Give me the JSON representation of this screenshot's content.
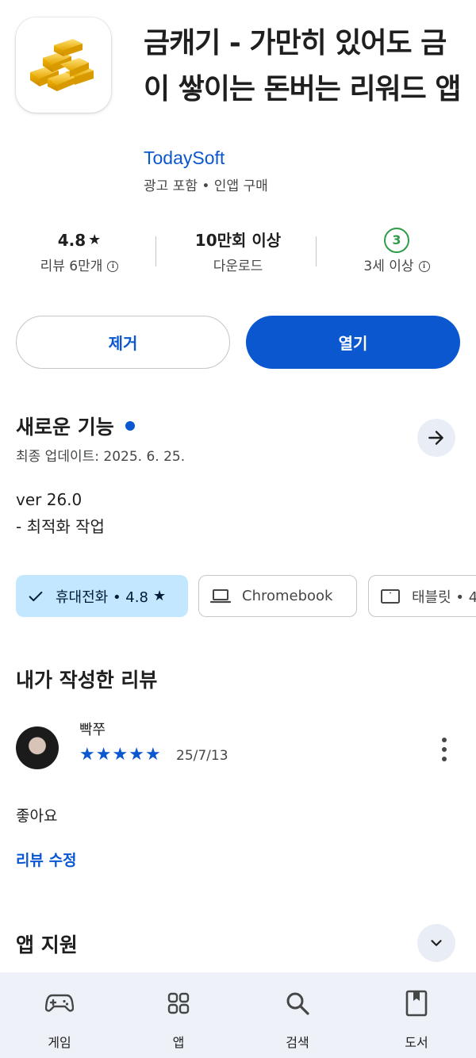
{
  "app": {
    "title": "금캐기 - 가만히 있어도 금이 쌓이는 돈버는 리워드 앱",
    "developer": "TodaySoft",
    "meta": "광고 포함 • 인앱 구매",
    "icon": "gold-bars-icon"
  },
  "stats": {
    "rating_value": "4.8",
    "rating_label": "리뷰 6만개",
    "downloads_value": "10만회 이상",
    "downloads_label": "다운로드",
    "age_badge": "3",
    "age_label": "3세 이상"
  },
  "actions": {
    "remove_label": "제거",
    "open_label": "열기"
  },
  "whats_new": {
    "title": "새로운 기능",
    "updated": "최종 업데이트: 2025. 6. 25.",
    "version": "ver 26.0",
    "note": "- 최적화 작업"
  },
  "device_chips": [
    {
      "label": "휴대전화 • 4.8",
      "icon": "check-icon",
      "selected": true
    },
    {
      "label": "Chromebook",
      "icon": "laptop-icon",
      "selected": false
    },
    {
      "label": "태블릿 • 4",
      "icon": "tablet-icon",
      "selected": false
    }
  ],
  "my_review": {
    "title": "내가 작성한 리뷰",
    "reviewer": "빡쭈",
    "stars": 5,
    "date": "25/7/13",
    "text": "좋아요",
    "edit_label": "리뷰 수정"
  },
  "app_support": {
    "title": "앱 지원"
  },
  "bottom_nav": [
    {
      "label": "게임",
      "icon": "gamepad-icon"
    },
    {
      "label": "앱",
      "icon": "apps-grid-icon"
    },
    {
      "label": "검색",
      "icon": "search-icon"
    },
    {
      "label": "도서",
      "icon": "book-icon"
    }
  ],
  "colors": {
    "accent": "#0b57d0",
    "chip_selected": "#c2e7ff",
    "age_green": "#2e9d4a",
    "nav_bg": "#eef2f8"
  }
}
